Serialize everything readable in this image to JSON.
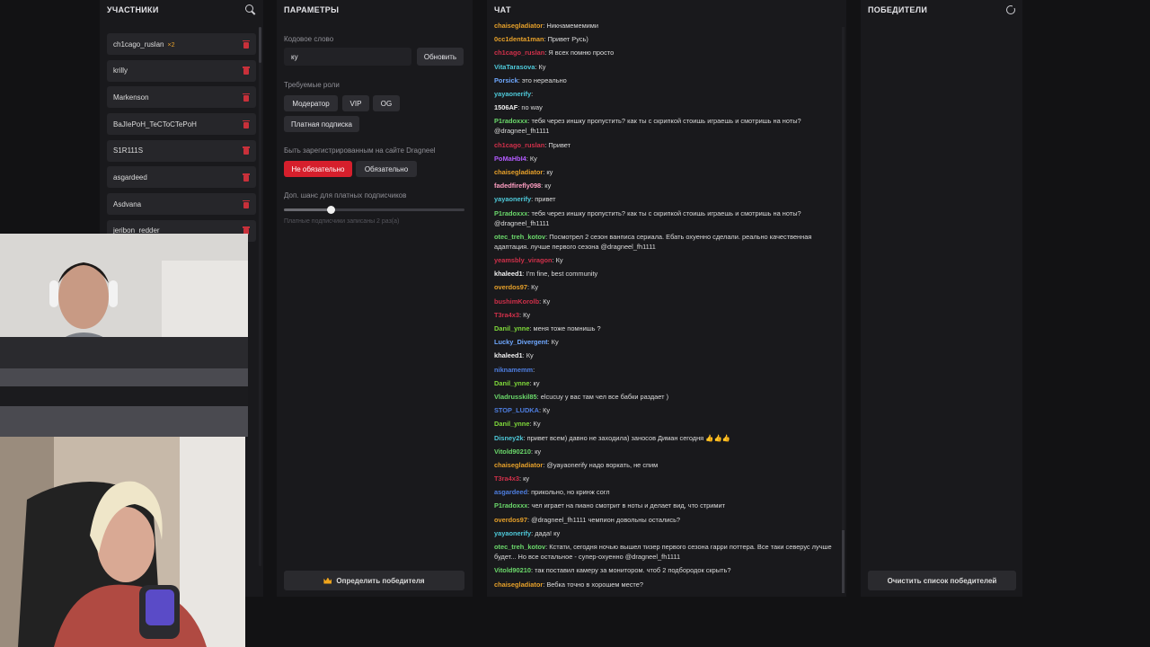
{
  "participants": {
    "title": "УЧАСТНИКИ",
    "items": [
      {
        "name": "ch1cago_ruslan",
        "count": "×2"
      },
      {
        "name": "krilly",
        "count": ""
      },
      {
        "name": "Markenson",
        "count": ""
      },
      {
        "name": "BaJIePoH_TeCToCTePoH",
        "count": ""
      },
      {
        "name": "S1R111S",
        "count": ""
      },
      {
        "name": "asgardeed",
        "count": ""
      },
      {
        "name": "Asdvana",
        "count": ""
      },
      {
        "name": "jeribon_redder",
        "count": ""
      }
    ]
  },
  "params": {
    "title": "ПАРАМЕТРЫ",
    "keyword_label": "Кодовое слово",
    "keyword_value": "ку",
    "refresh_label": "Обновить",
    "roles_label": "Требуемые роли",
    "roles": [
      "Модератор",
      "VIP",
      "OG",
      "Платная подписка"
    ],
    "registered_label": "Быть зарегистрированным на сайте Dragneel",
    "opt_not_required": "Не обязательно",
    "opt_required": "Обязательно",
    "bonus_label": "Доп. шанс для платных подписчиков",
    "bonus_level": 0.26,
    "bonus_hint": "Платные подписчики записаны 2 раз(а)",
    "pick_winner": "Определить победителя"
  },
  "chat": {
    "title": "ЧАТ",
    "messages": [
      {
        "nick": "chaisegladiator",
        "color": "#e6a02a",
        "text": "Никнамемемими"
      },
      {
        "nick": "0cc1denta1man",
        "color": "#e6a02a",
        "text": "Привет Русь)"
      },
      {
        "nick": "ch1cago_ruslan",
        "color": "#d0304a",
        "text": "Я всех помню просто"
      },
      {
        "nick": "VitaTarasova",
        "color": "#4ec9d9",
        "text": "Ку"
      },
      {
        "nick": "Porsick",
        "color": "#6fa8ff",
        "text": "это нереально"
      },
      {
        "nick": "yayaonerify",
        "color": "#4ec9d9",
        "text": ""
      },
      {
        "nick": "1506AF",
        "color": "#f0f0f0",
        "text": "no way"
      },
      {
        "nick": "P1radoxxx",
        "color": "#6bd96b",
        "text": "тебя через иншку пропустить? как ты с скрипкой стоишь играешь и смотришь на ноты? @dragneel_fh1111"
      },
      {
        "nick": "ch1cago_ruslan",
        "color": "#d0304a",
        "text": "Привет"
      },
      {
        "nick": "PoMaHbI4",
        "color": "#b35bff",
        "text": "Ку"
      },
      {
        "nick": "chaisegladiator",
        "color": "#e6a02a",
        "text": "ку"
      },
      {
        "nick": "fadedfirefly098",
        "color": "#ff9ec2",
        "text": "ку"
      },
      {
        "nick": "yayaonerify",
        "color": "#4ec9d9",
        "text": "привет"
      },
      {
        "nick": "P1radoxxx",
        "color": "#6bd96b",
        "text": "тебя через иншку пропустить? как ты с скрипкой стоишь играешь и смотришь на ноты? @dragneel_fh1111"
      },
      {
        "nick": "otec_treh_kotov",
        "color": "#6bd96b",
        "text": "Посмотрел 2 сезон ванписа сериала. Ебать охуенно сделали. реально качественная адаптация. лучше первого сезона @dragneel_fh1111"
      },
      {
        "nick": "yeamsbly_viragon",
        "color": "#d0304a",
        "text": "Ку"
      },
      {
        "nick": "khaleed1",
        "color": "#f0f0f0",
        "text": "I'm fine, best community"
      },
      {
        "nick": "overdos97",
        "color": "#e6a02a",
        "text": "Ку"
      },
      {
        "nick": "bushimKorolb",
        "color": "#d0304a",
        "text": "Ку"
      },
      {
        "nick": "T3ra4x3",
        "color": "#d0304a",
        "text": "Ку"
      },
      {
        "nick": "Danil_ynne",
        "color": "#7fd93a",
        "text": "меня тоже помнишь ?"
      },
      {
        "nick": "Lucky_Divergent",
        "color": "#6fa8ff",
        "text": "Ку"
      },
      {
        "nick": "khaleed1",
        "color": "#f0f0f0",
        "text": "Ку"
      },
      {
        "nick": "niknamemm",
        "color": "#4e7ee0",
        "text": ""
      },
      {
        "nick": "Danil_ynne",
        "color": "#7fd93a",
        "text": "ку"
      },
      {
        "nick": "Vladrusskil85",
        "color": "#6bd96b",
        "text": "elcucuy у вас там чел все бабки раздает )"
      },
      {
        "nick": "STOP_LUDKA",
        "color": "#4e7ee0",
        "text": "Ку"
      },
      {
        "nick": "Danil_ynne",
        "color": "#7fd93a",
        "text": "Ку"
      },
      {
        "nick": "Disney2k",
        "color": "#4ec9d9",
        "text": "привет всем) давно не заходила) заносов Диман сегодня 👍👍👍"
      },
      {
        "nick": "Vitold90210",
        "color": "#6bd96b",
        "text": "ку"
      },
      {
        "nick": "chaisegladiator",
        "color": "#e6a02a",
        "text": "@yayaonerify надо воркать, не спим"
      },
      {
        "nick": "T3ra4x3",
        "color": "#d0304a",
        "text": "ку"
      },
      {
        "nick": "asgardeed",
        "color": "#4e7ee0",
        "text": "прикольно, но кринж согл"
      },
      {
        "nick": "P1radoxxx",
        "color": "#6bd96b",
        "text": "чел играет на пиано смотрит в ноты и делает вид, что стримит"
      },
      {
        "nick": "overdos97",
        "color": "#e6a02a",
        "text": "@dragneel_fh1111 чемпион довольны остались?"
      },
      {
        "nick": "yayaonerify",
        "color": "#4ec9d9",
        "text": "дада! ку"
      },
      {
        "nick": "otec_treh_kotov",
        "color": "#6bd96b",
        "text": "Кстати, сегодня ночью вышел тизер первого сезона гарри поттера. Все таки северус лучше будет... Но все остальное - супер-охуенно @dragneel_fh1111"
      },
      {
        "nick": "Vitold90210",
        "color": "#6bd96b",
        "text": "так поставил камеру за монитором. чтоб 2 подбородок скрыть?"
      },
      {
        "nick": "chaisegladiator",
        "color": "#e6a02a",
        "text": "Вебка точно в хорошем месте?"
      }
    ]
  },
  "winners": {
    "title": "ПОБЕДИТЕЛИ",
    "clear_label": "Очистить список победителей"
  },
  "colors": {
    "accent": "#d61f2c",
    "panel": "#19191c",
    "background": "#121214"
  }
}
